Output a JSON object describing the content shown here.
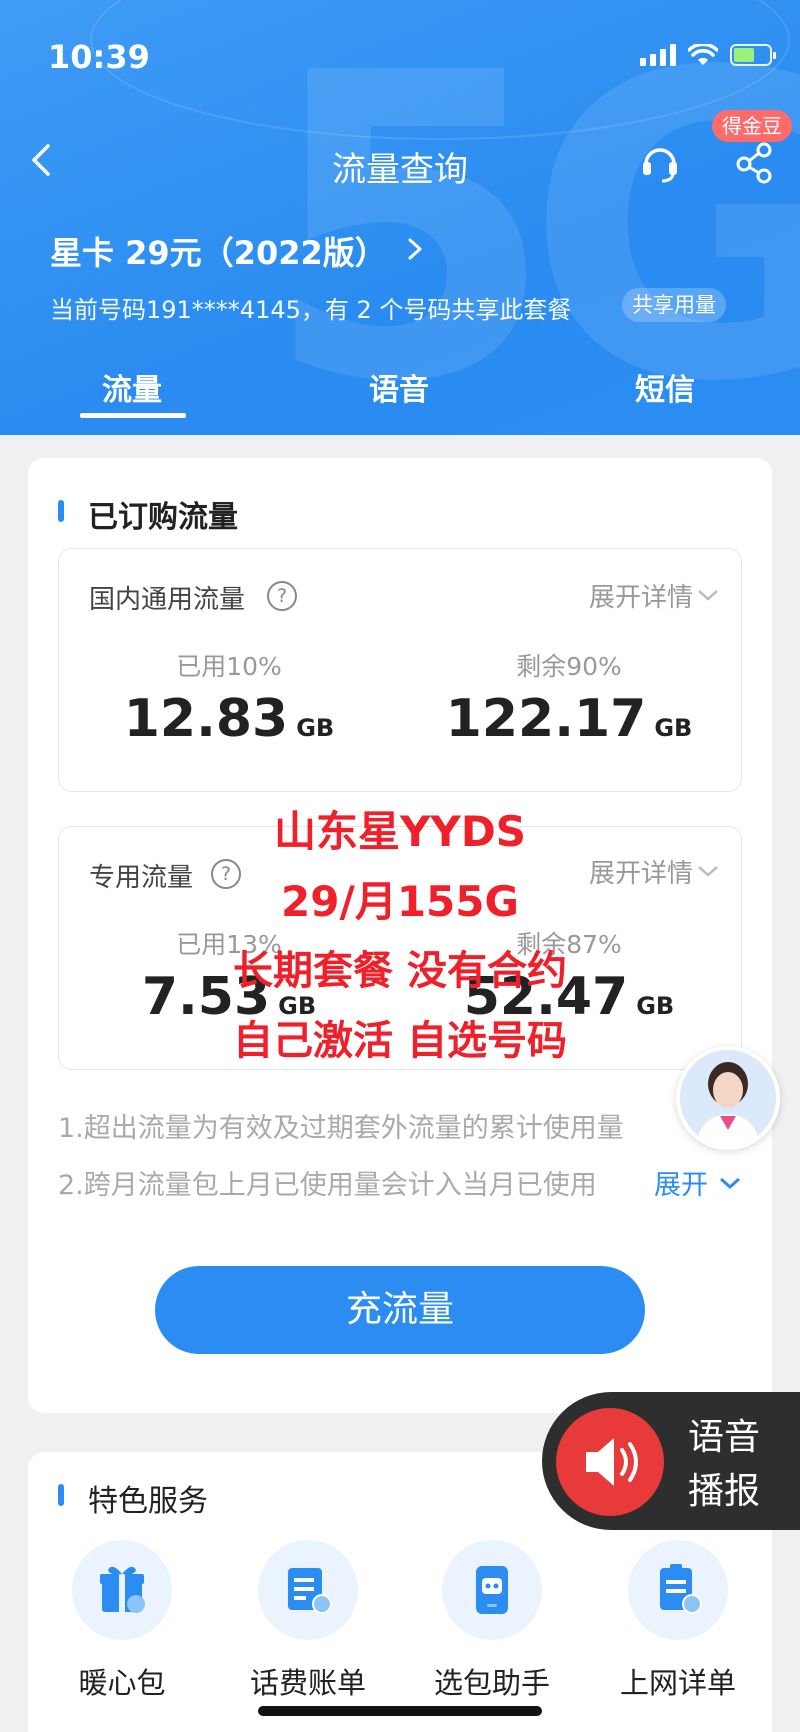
{
  "status_bar": {
    "time": "10:39"
  },
  "nav": {
    "title": "流量查询",
    "badge": "得金豆"
  },
  "plan": {
    "name": "星卡 29元（2022版）",
    "subtitle": "当前号码191****4145，有 2 个号码共享此套餐",
    "share_chip": "共享用量"
  },
  "tabs": [
    {
      "label": "流量"
    },
    {
      "label": "语音"
    },
    {
      "label": "短信"
    }
  ],
  "subscribed": {
    "title": "已订购流量",
    "domestic": {
      "label": "国内通用流量",
      "expand": "展开详情",
      "used_label": "已用10%",
      "used_value": "12.83",
      "remain_label": "剩余90%",
      "remain_value": "122.17",
      "unit": "GB"
    },
    "dedicated": {
      "label": "专用流量",
      "expand": "展开详情",
      "used_label": "已用13%",
      "used_value": "7.53",
      "remain_label": "剩余87%",
      "remain_value": "52.47",
      "unit": "GB"
    },
    "notes": [
      "1.超出流量为有效及过期套外流量的累计使用量",
      "2.跨月流量包上月已使用量会计入当月已使用"
    ],
    "expand_link": "展开",
    "recharge": "充流量"
  },
  "overlay": [
    "山东星YYDS",
    "29/月155G",
    "长期套餐 没有合约",
    "自己激活 自选号码"
  ],
  "services": {
    "title": "特色服务",
    "items": [
      {
        "label": "暖心包",
        "icon": "gift-icon"
      },
      {
        "label": "话费账单",
        "icon": "bill-search-icon"
      },
      {
        "label": "选包助手",
        "icon": "robot-phone-icon"
      },
      {
        "label": "上网详单",
        "icon": "data-detail-icon"
      }
    ]
  },
  "voice": {
    "line1": "语音",
    "line2": "播报"
  },
  "colors": {
    "brand_blue": "#2b8df2",
    "overlay_red": "#f0202a",
    "badge_red": "#ff6b6b"
  }
}
